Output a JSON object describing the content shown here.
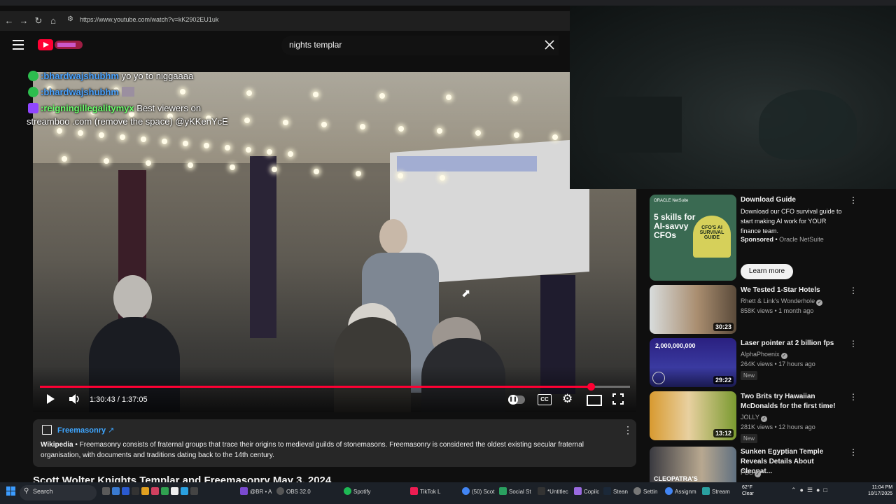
{
  "browser": {
    "url": "https://www.youtube.com/watch?v=kK2902EU1uk",
    "back_icon": "arrow-left",
    "forward_icon": "arrow-right",
    "reload_icon": "reload",
    "home_icon": "home"
  },
  "header": {
    "search_value": "nights templar"
  },
  "chat": [
    {
      "user": ":bhardwajshubhm",
      "message": "yo yo to niggaaaa"
    },
    {
      "user": ":bhardwajshubhm",
      "message": ""
    },
    {
      "user": ":reigningillegalitymyx",
      "message": "Best viewers on"
    },
    {
      "user": "",
      "message": "streamboo .com (remove the space) @yKKenYcE"
    }
  ],
  "player": {
    "time": "1:30:43 / 1:37:05",
    "progress_fraction": 0.934
  },
  "info_panel": {
    "title": "Freemasonry",
    "source": "Wikipedia",
    "text": "Freemasonry consists of fraternal groups that trace their origins to medieval guilds of stonemasons. Freemasonry is considered the oldest existing secular fraternal organisation, with documents and traditions dating back to the 14th century."
  },
  "video_title": "Scott Wolter Knights Templar and Freemasonry May 3, 2024",
  "ad": {
    "thumb_brand": "ORACLE NetSuite",
    "thumb_headline": "5 skills for AI-savvy CFOs",
    "thumb_badge": "CFO'S AI SURVIVAL GUIDE",
    "title": "Download Guide",
    "description": "Download our CFO survival guide to start making AI work for YOUR finance team.",
    "sponsored": "Sponsored",
    "advertiser": "Oracle NetSuite",
    "cta": "Learn more"
  },
  "recommendations": [
    {
      "title": "We Tested 1-Star Hotels",
      "channel": "Rhett & Link's Wonderhole",
      "meta": "858K views • 1 month ago",
      "duration": "30:23",
      "badge": ""
    },
    {
      "title": "Laser pointer at 2 billion fps",
      "channel": "AlphaPhoenix",
      "meta": "264K views • 17 hours ago",
      "duration": "29:22",
      "badge": "New",
      "thumb_text": "2,000,000,000"
    },
    {
      "title": "Two Brits try Hawaiian McDonalds for the first time!",
      "channel": "JOLLY",
      "meta": "281K views • 12 hours ago",
      "duration": "13:12",
      "badge": "New"
    },
    {
      "title": "Sunken Egyptian Temple Reveals Details About Cleopat...",
      "channel": "PBS",
      "meta": "",
      "duration": "",
      "badge": "",
      "thumb_text": "CLEOPATRA'S"
    }
  ],
  "taskbar": {
    "search_label": "Search",
    "apps": [
      "@BR • A",
      "OBS 32.0",
      "Spotify",
      "TikTok L",
      "(50) Scot",
      "Social St",
      "*Untitlec",
      "Copilc",
      "Stean",
      "Settin",
      "Assignm",
      "Stream"
    ],
    "weather_temp": "62°F",
    "weather_desc": "Clear",
    "time": "11:04 PM",
    "date": "10/17/2025"
  }
}
